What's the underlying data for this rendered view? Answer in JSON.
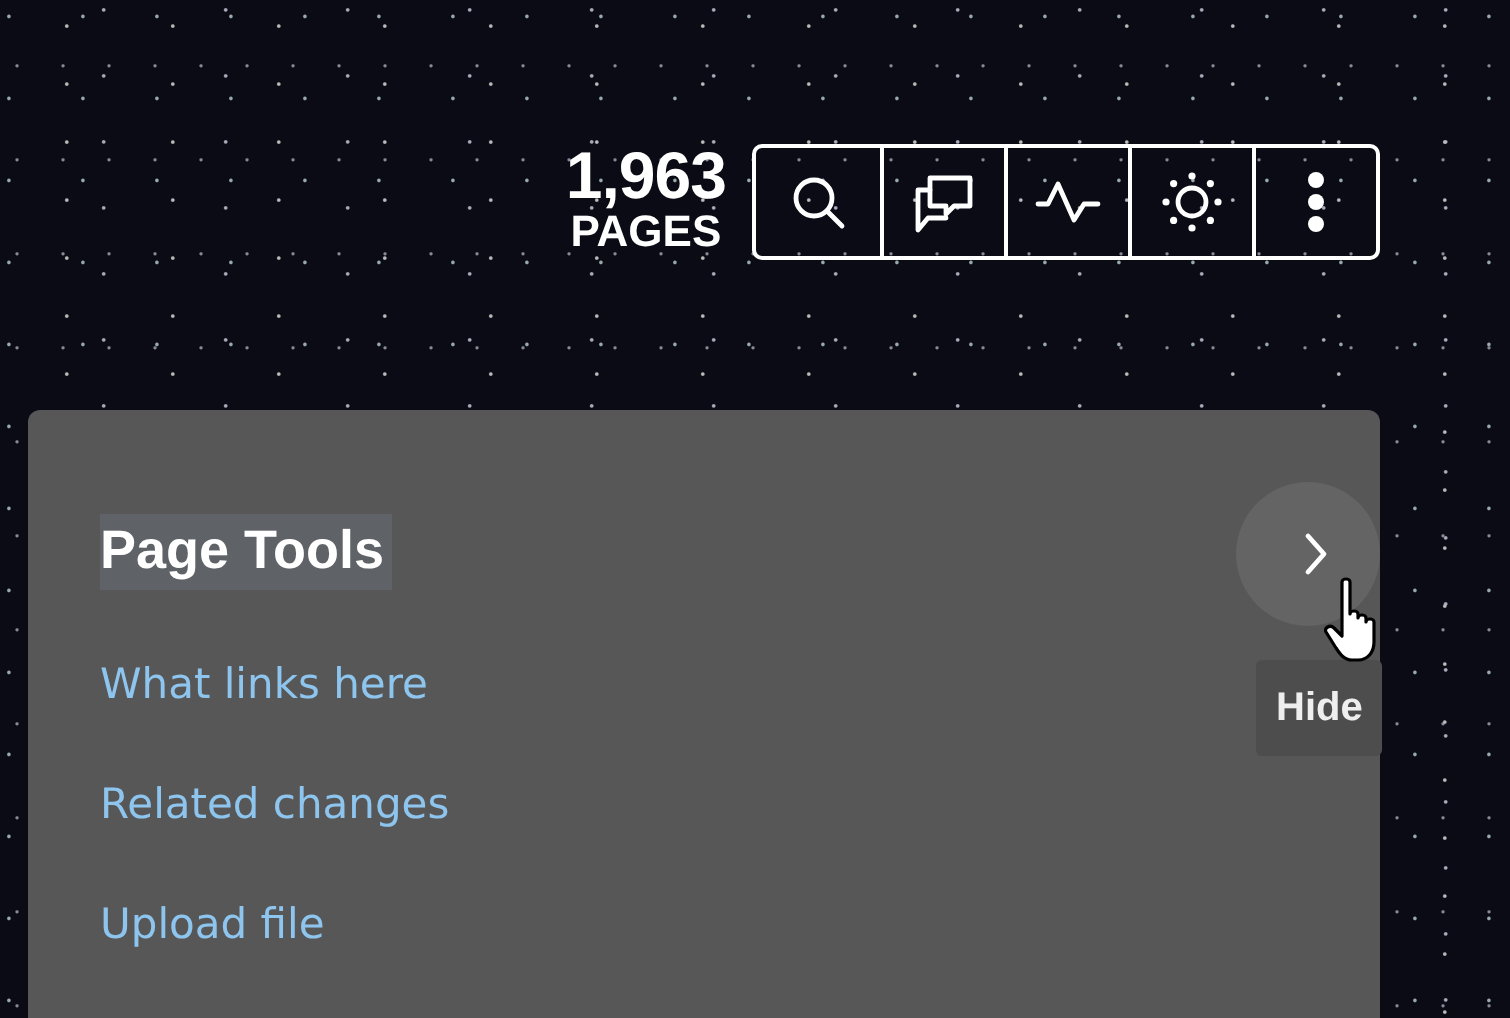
{
  "counter": {
    "value": "1,963",
    "label": "PAGES"
  },
  "toolbar": [
    {
      "kind": "search"
    },
    {
      "kind": "discussion"
    },
    {
      "kind": "activity"
    },
    {
      "kind": "theme"
    },
    {
      "kind": "more"
    }
  ],
  "panel": {
    "title": "Page Tools",
    "hide_tooltip": "Hide",
    "links": [
      "What links here",
      "Related changes",
      "Upload file"
    ]
  }
}
